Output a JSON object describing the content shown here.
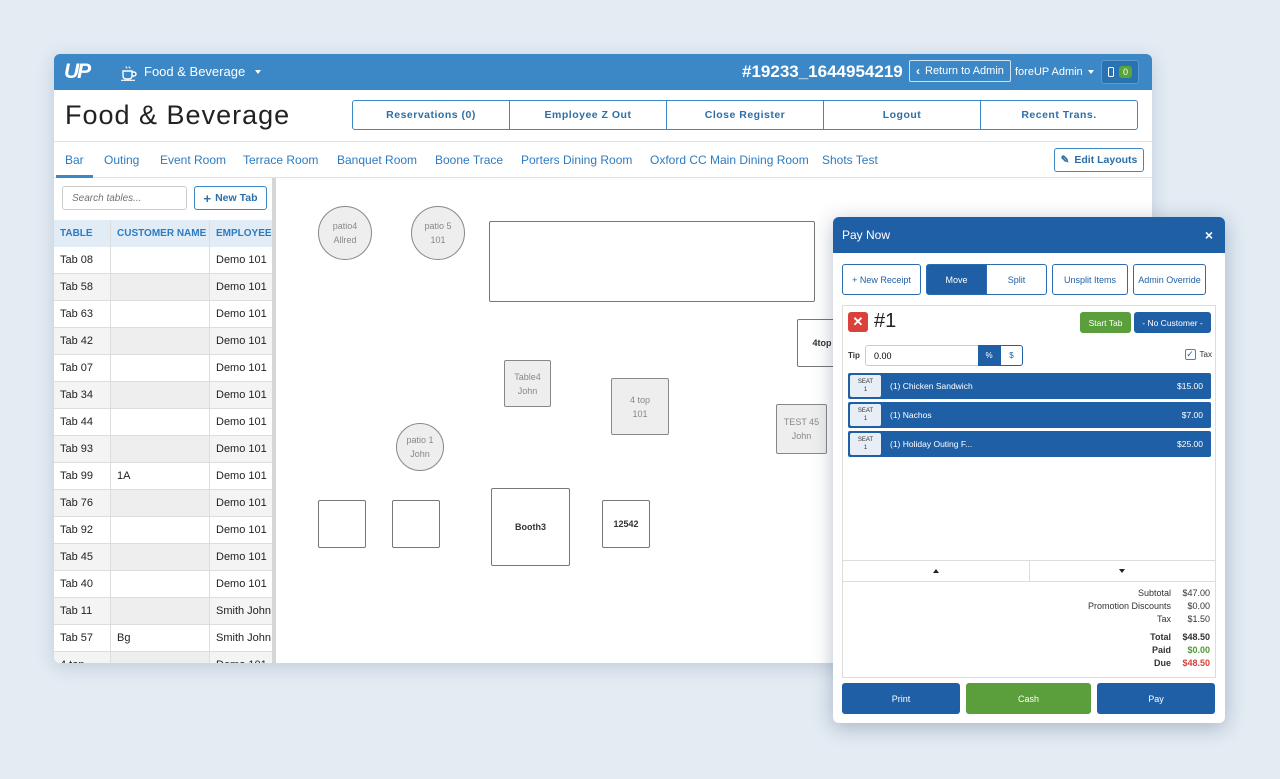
{
  "topbar": {
    "logo": "UP",
    "module": "Food & Beverage",
    "register_id": "#19233_1644954219",
    "return_label": "Return to Admin",
    "admin_label": "foreUP Admin",
    "device_count": "0"
  },
  "header": {
    "title": "Food & Beverage",
    "actions": [
      "Reservations (0)",
      "Employee Z Out",
      "Close Register",
      "Logout",
      "Recent Trans."
    ]
  },
  "tabs": [
    "Bar",
    "Outing",
    "Event Room",
    "Terrace Room",
    "Banquet Room",
    "Boone Trace",
    "Porters Dining Room",
    "Oxford CC Main Dining Room",
    "Shots Test"
  ],
  "edit_layouts_label": "Edit Layouts",
  "sidebar": {
    "search_placeholder": "Search tables...",
    "new_tab_label": "New Tab",
    "columns": [
      "TABLE",
      "CUSTOMER NAME",
      "EMPLOYEE"
    ],
    "rows": [
      [
        "Tab 08",
        "",
        "Demo 101"
      ],
      [
        "Tab 58",
        "",
        "Demo 101"
      ],
      [
        "Tab 63",
        "",
        "Demo 101"
      ],
      [
        "Tab 42",
        "",
        "Demo 101"
      ],
      [
        "Tab 07",
        "",
        "Demo 101"
      ],
      [
        "Tab 34",
        "",
        "Demo 101"
      ],
      [
        "Tab 44",
        "",
        "Demo 101"
      ],
      [
        "Tab 93",
        "",
        "Demo 101"
      ],
      [
        "Tab 99",
        "1A",
        "Demo 101"
      ],
      [
        "Tab 76",
        "",
        "Demo 101"
      ],
      [
        "Tab 92",
        "",
        "Demo 101"
      ],
      [
        "Tab 45",
        "",
        "Demo 101"
      ],
      [
        "Tab 40",
        "",
        "Demo 101"
      ],
      [
        "Tab 11",
        "",
        "Smith John"
      ],
      [
        "Tab 57",
        "Bg",
        "Smith John"
      ],
      [
        "4 top",
        "",
        "Demo 101"
      ]
    ]
  },
  "floor": {
    "tables": [
      {
        "name": "patio4",
        "server": "Allred"
      },
      {
        "name": "patio 5",
        "server": "101"
      },
      {
        "name": "",
        "server": ""
      },
      {
        "name": "4top",
        "server": ""
      },
      {
        "name": "Table4",
        "server": "John"
      },
      {
        "name": "4 top",
        "server": "101"
      },
      {
        "name": "TEST 45",
        "server": "John"
      },
      {
        "name": "patio 1",
        "server": "John"
      },
      {
        "name": "",
        "server": ""
      },
      {
        "name": "",
        "server": ""
      },
      {
        "name": "Booth3",
        "server": ""
      },
      {
        "name": "12542",
        "server": ""
      }
    ]
  },
  "modal": {
    "title": "Pay Now",
    "close": "×",
    "buttons": [
      "+ New Receipt",
      "Move",
      "Split",
      "Unsplit Items",
      "Admin Override"
    ],
    "receipt_number": "#1",
    "start_tab": "Start Tab",
    "no_customer": "- No Customer -",
    "tip_label": "Tip",
    "tip_value": "0.00",
    "pct": "%",
    "dollar": "$",
    "tax_label": "Tax",
    "seat_label": "SEAT",
    "items": [
      {
        "seat": "1",
        "name": "(1) Chicken Sandwich",
        "price": "$15.00"
      },
      {
        "seat": "1",
        "name": "(1) Nachos",
        "price": "$7.00"
      },
      {
        "seat": "1",
        "name": "(1) Holiday Outing F...",
        "price": "$25.00"
      }
    ],
    "totals": {
      "subtotal_label": "Subtotal",
      "subtotal": "$47.00",
      "promo_label": "Promotion Discounts",
      "promo": "$0.00",
      "tax_label": "Tax",
      "tax": "$1.50",
      "total_label": "Total",
      "total": "$48.50",
      "paid_label": "Paid",
      "paid": "$0.00",
      "due_label": "Due",
      "due": "$48.50"
    },
    "footer": [
      "Print",
      "Cash",
      "Pay"
    ]
  },
  "colors": {
    "brand_blue": "#3c87c5",
    "modal_blue": "#1f5fa6",
    "success_green": "#5a9f3c",
    "danger_red": "#d9413a"
  }
}
